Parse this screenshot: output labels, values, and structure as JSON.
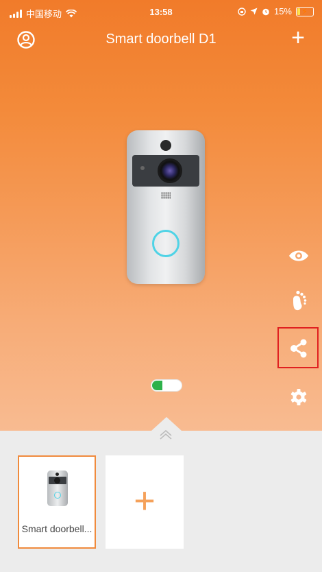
{
  "status_bar": {
    "carrier": "中国移动",
    "time": "13:58",
    "battery": "15%",
    "battery_level": 0.15
  },
  "nav": {
    "title": "Smart doorbell D1",
    "add_label": "+"
  },
  "actions": [
    {
      "name": "eye-icon"
    },
    {
      "name": "footprint-icon"
    },
    {
      "name": "share-icon"
    },
    {
      "name": "settings-gear-icon"
    }
  ],
  "devices": {
    "items": [
      {
        "label": "Smart doorbell..."
      }
    ],
    "add_label": "+"
  },
  "colors": {
    "accent": "#f17b2a",
    "highlight": "#e02020",
    "toggle_on": "#2eb14a",
    "ring": "#4fd3e6"
  }
}
